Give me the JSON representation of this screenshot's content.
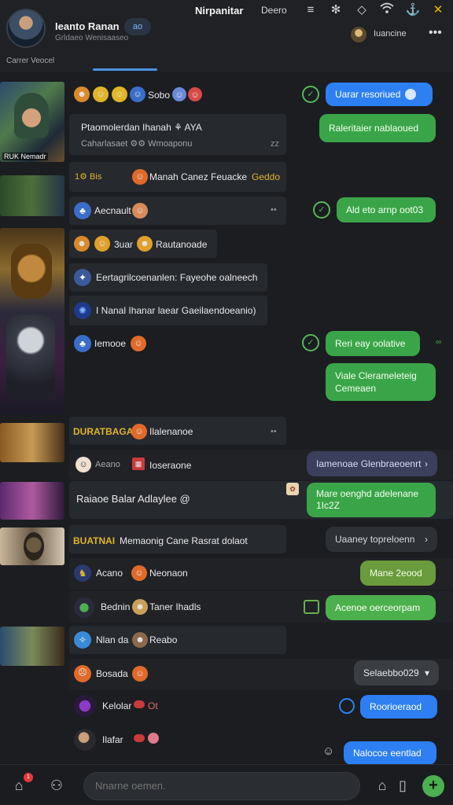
{
  "header": {
    "name": "Ieanto Ranan",
    "subtitle": "Grldaeo Wenisaaseo",
    "pill": "ao",
    "title": "Nirpanitar",
    "mode": "Deero",
    "username": "Iuancine",
    "tab": "Carrer Veocel",
    "icons": [
      "menu-icon",
      "settings-icon",
      "diamond-icon",
      "wifi-icon",
      "anchor-icon",
      "close-icon"
    ]
  },
  "thumbs": [
    {
      "label": "RUK Nemadr"
    },
    {
      "label": ""
    },
    {
      "label": ""
    },
    {
      "label": ""
    },
    {
      "label": ""
    },
    {
      "label": ""
    },
    {
      "label": ""
    }
  ],
  "messages": [
    {
      "text": "Sobo"
    },
    {
      "text": "Ptaomolerdan Ihanah ⚘ AYA",
      "sub": "Caharlasaet ⚙⚙ Wmoaponu",
      "time": "zz"
    },
    {
      "text": "Manah Canez Feuacke",
      "tag": "Geddo",
      "prefix": "1⚙ Bis"
    },
    {
      "text": "Aecnault"
    },
    {
      "text": "3uar",
      "tail": "Rautanoade"
    },
    {
      "text": "Eertagrilcoenanlen: Fayeohe oalneech"
    },
    {
      "text": "I Nanal Ihanar laear Gaeilaendoeanio)"
    },
    {
      "text": "Iemooe"
    },
    {
      "text": "Ilalenanoe",
      "tag": "DURATBAGAI"
    },
    {
      "text": "Ioseraone",
      "sub": "Aeano"
    },
    {
      "text": "Raiaoe Balar Adlaylee @"
    },
    {
      "text": "Memaonig Cane Rasrat dolaot",
      "tag": "BUATNAI"
    },
    {
      "text": "Acano",
      "tail": "Neonaon"
    },
    {
      "text": "Bednin",
      "tail": "Taner Ihadls"
    },
    {
      "text": "Nlan da",
      "tail": "Reabo"
    },
    {
      "text": "Bosada"
    },
    {
      "text": "Kelolar",
      "tail": "Ot"
    },
    {
      "text": "Ilafar"
    }
  ],
  "bubbles": [
    {
      "text": "Uarar resoriued"
    },
    {
      "text": "Raleritaier nablaoued"
    },
    {
      "text": "Ald eto arnp oot03"
    },
    {
      "text": "Reri eay oolative"
    },
    {
      "text": "Viale Clerameleteig Cemeaen"
    },
    {
      "text": "Iamenoae Glenbraeoenrt"
    },
    {
      "text": "Mare oenghd adelenane 1Ic2Z"
    },
    {
      "text": "Uaaney topreloenn"
    },
    {
      "text": "Mane 2eood"
    },
    {
      "text": "Acenoe oerceorpam"
    },
    {
      "text": "Selaebbo029"
    },
    {
      "text": "Roorioeraod"
    },
    {
      "text": "Nalocoe eentlad"
    }
  ],
  "footer": {
    "placeholder": "Nnarne oemen.",
    "badge": "1"
  },
  "colors": {
    "accent": "#4a90e2",
    "bubble_green": "#3aa548",
    "bubble_blue": "#2d7ff2"
  }
}
